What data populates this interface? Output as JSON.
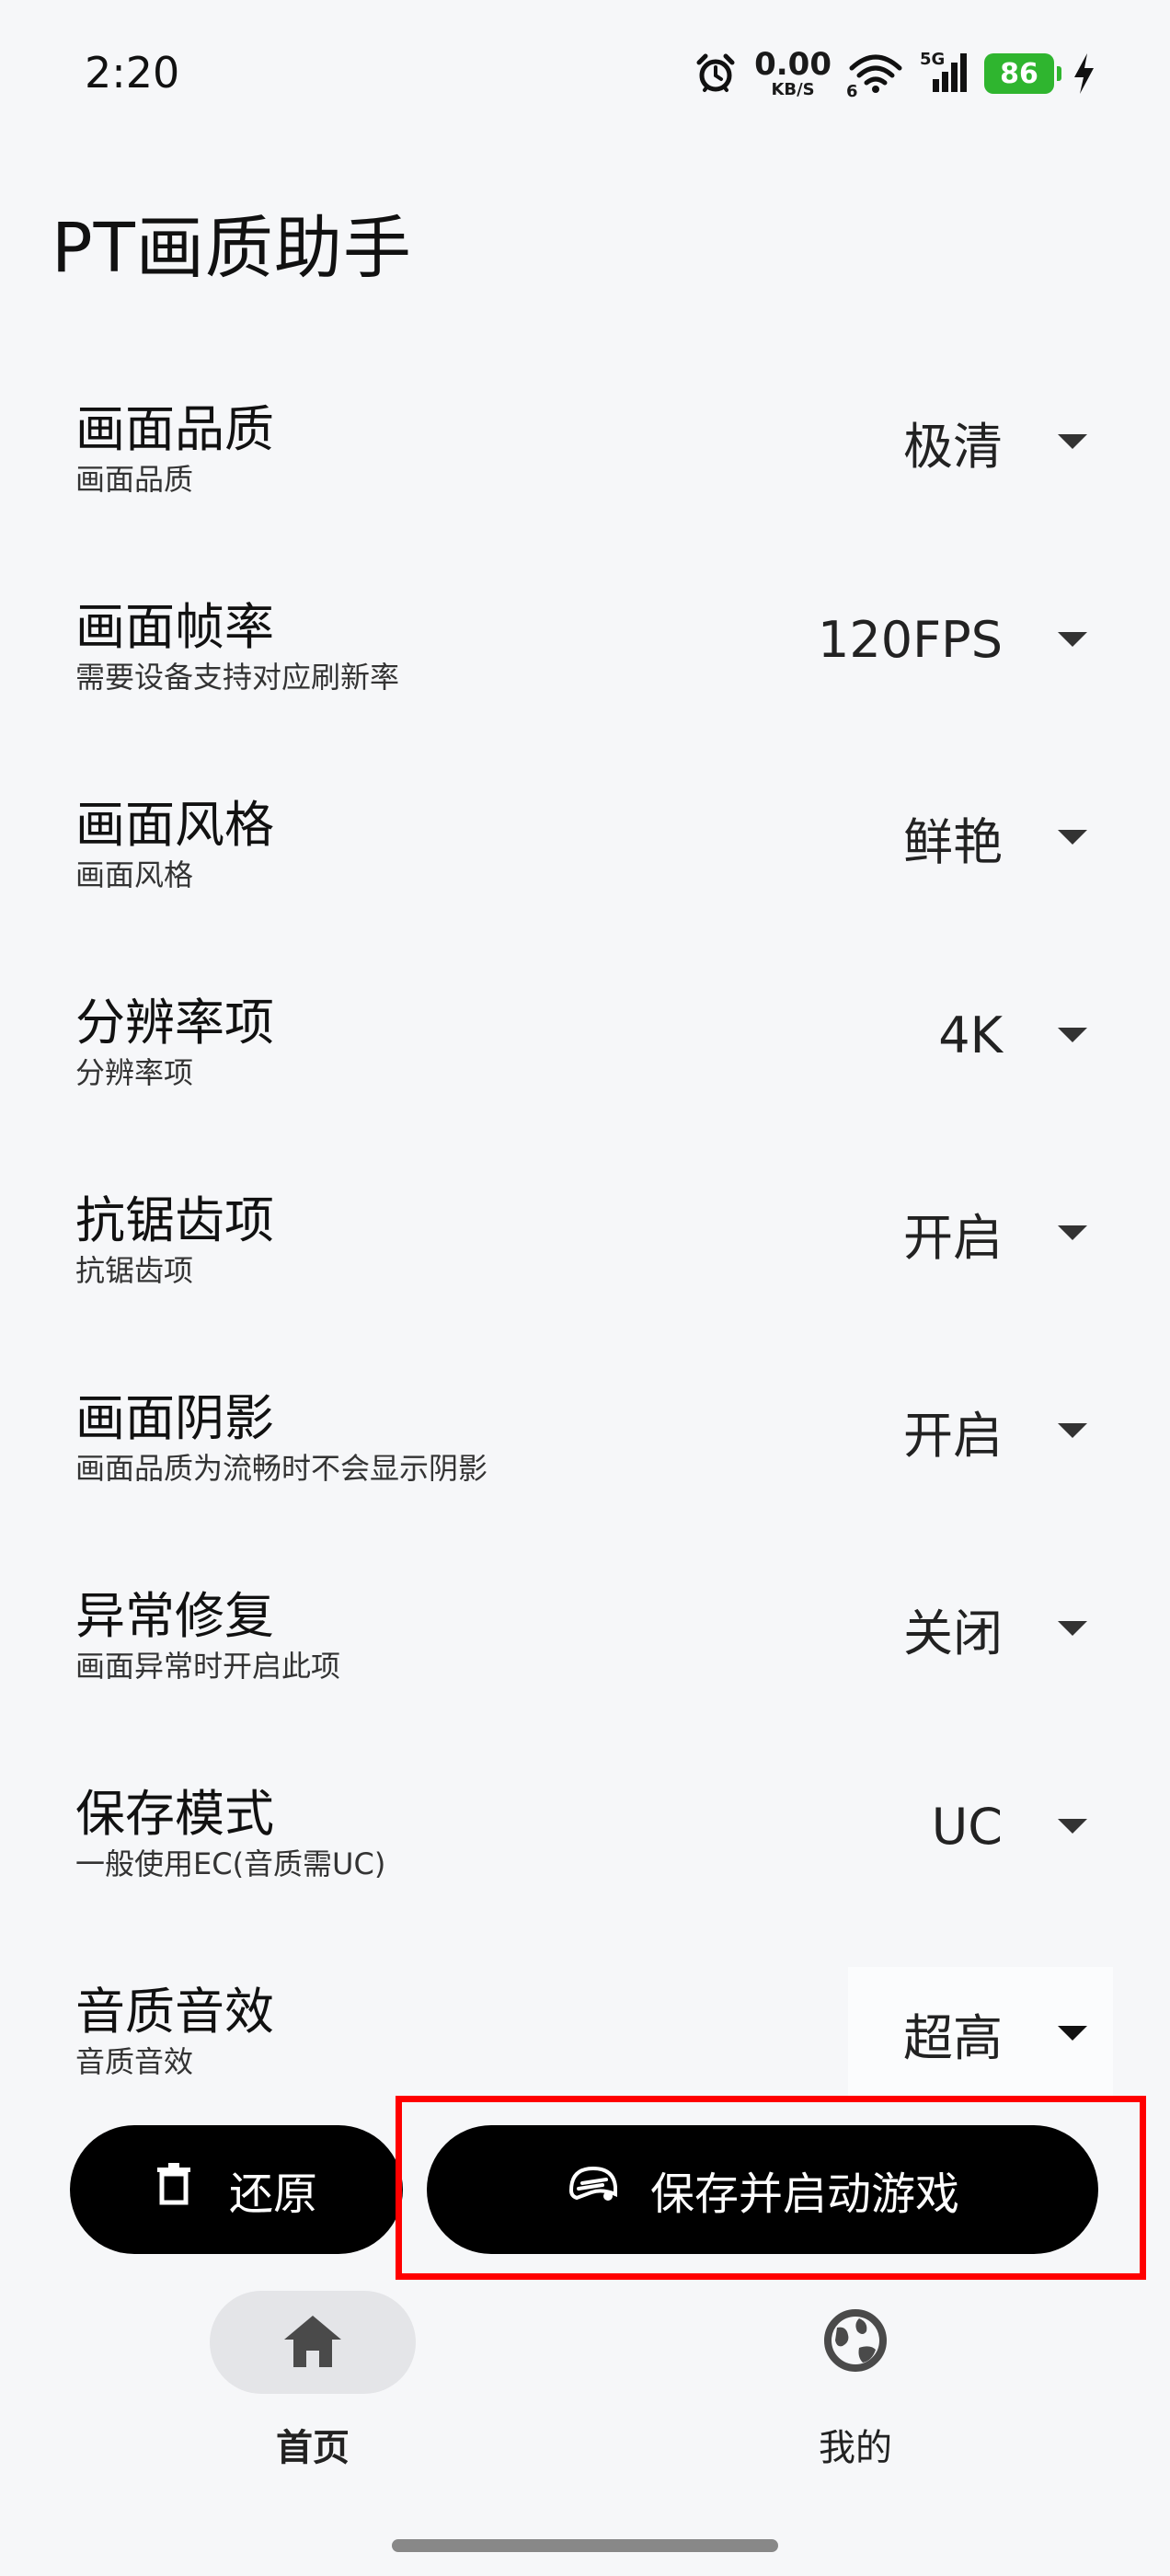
{
  "status_bar": {
    "time": "2:20",
    "net_speed_value": "0.00",
    "net_speed_unit": "KB/S",
    "wifi_badge": "6",
    "signal_badge": "5G",
    "battery_level": "86",
    "icons": [
      "alarm-icon",
      "wifi-icon",
      "signal-icon",
      "battery-icon",
      "charging-icon"
    ]
  },
  "app": {
    "title": "PT画质助手"
  },
  "settings": [
    {
      "title": "画面品质",
      "subtitle": "画面品质",
      "value": "极清"
    },
    {
      "title": "画面帧率",
      "subtitle": "需要设备支持对应刷新率",
      "value": "120FPS"
    },
    {
      "title": "画面风格",
      "subtitle": "画面风格",
      "value": "鲜艳"
    },
    {
      "title": "分辨率项",
      "subtitle": "分辨率项",
      "value": "4K"
    },
    {
      "title": "抗锯齿项",
      "subtitle": "抗锯齿项",
      "value": "开启"
    },
    {
      "title": "画面阴影",
      "subtitle": "画面品质为流畅时不会显示阴影",
      "value": "开启"
    },
    {
      "title": "异常修复",
      "subtitle": "画面异常时开启此项",
      "value": "关闭"
    },
    {
      "title": "保存模式",
      "subtitle": "一般使用EC(音质需UC)",
      "value": "UC"
    },
    {
      "title": "音质音效",
      "subtitle": "音质音效",
      "value": "超高"
    }
  ],
  "actions": {
    "restore_label": "还原",
    "launch_label": "保存并启动游戏"
  },
  "bottom_nav": {
    "home_label": "首页",
    "mine_label": "我的",
    "active": "home"
  },
  "colors": {
    "background": "#f6f7f9",
    "button": "#000000",
    "highlight_box": "#ff0000",
    "battery": "#2fb52f",
    "nav_active_pill": "#e4e5e8"
  }
}
